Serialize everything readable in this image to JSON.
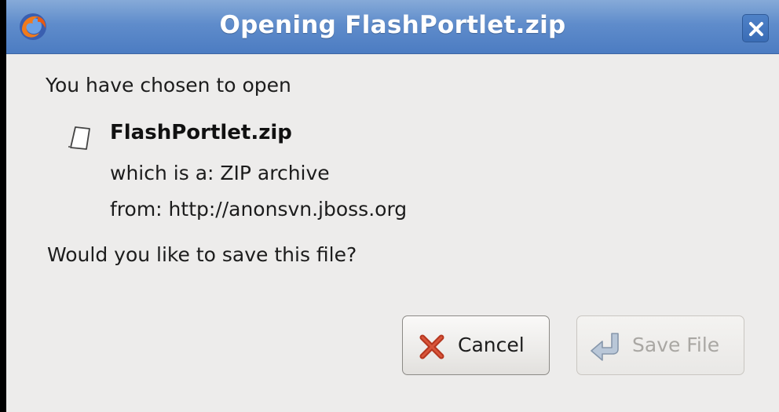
{
  "window": {
    "title": "Opening FlashPortlet.zip",
    "app_icon": "firefox-icon",
    "close_icon": "close-icon"
  },
  "dialog": {
    "intro": "You have chosen to open",
    "file_icon": "document-icon",
    "filename": "FlashPortlet.zip",
    "which_is": "which is a:  ZIP archive",
    "from": "from:  http://anonsvn.jboss.org",
    "question": "Would you like to save this file?"
  },
  "buttons": {
    "cancel": {
      "label": "Cancel",
      "icon": "x-icon"
    },
    "save": {
      "label": "Save File",
      "icon": "save-arrow-icon",
      "disabled": true
    }
  },
  "colors": {
    "titlebar": "#5f8ccb",
    "background": "#edeceb",
    "cancel_x": "#b5361f"
  }
}
